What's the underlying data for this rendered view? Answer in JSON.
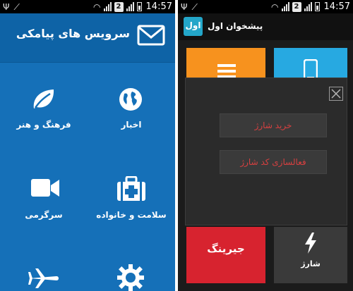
{
  "status_bar": {
    "time": "14:57",
    "sim_badge": "2"
  },
  "left_app": {
    "title": "سرویس های پیامکی",
    "categories": [
      {
        "label": "اخبار",
        "icon": "globe-icon"
      },
      {
        "label": "فرهنگ و هنر",
        "icon": "leaf-icon"
      },
      {
        "label": "سلامت و خانواده",
        "icon": "first-aid-kit-icon"
      },
      {
        "label": "سرگرمی",
        "icon": "video-camera-icon"
      },
      {
        "label": "",
        "icon": "gear-icon"
      },
      {
        "label": "",
        "icon": "airplane-icon"
      }
    ],
    "colors": {
      "background": "#1570b8",
      "header": "#0e63a6"
    }
  },
  "right_app": {
    "title": "پیشخوان اول",
    "logo_text": "اول",
    "tiles": [
      {
        "label": "",
        "color": "#f7921e",
        "icon": "list-icon"
      },
      {
        "label": "",
        "color": "#27a9e1",
        "icon": "phone-icon"
      },
      {
        "label": "جیرینگ",
        "color": "#d7232f",
        "icon": ""
      },
      {
        "label": "شارژ",
        "color": "#3a3a3a",
        "icon": "lightning-icon"
      }
    ],
    "dialog": {
      "buttons": [
        {
          "label": "خرید شارژ"
        },
        {
          "label": "فعالسازی کد شارژ"
        }
      ],
      "close_icon": "close-icon"
    }
  }
}
